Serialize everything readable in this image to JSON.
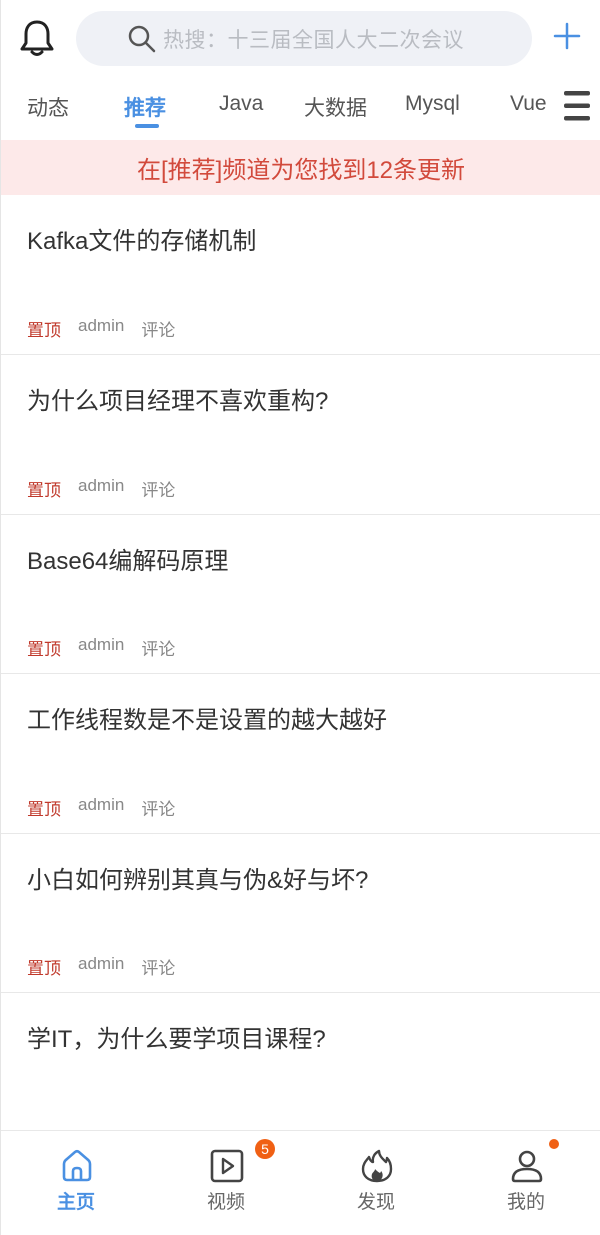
{
  "header": {
    "search_placeholder": "热搜：十三届全国人大二次会议"
  },
  "tabs": [
    {
      "label": "动态"
    },
    {
      "label": "推荐"
    },
    {
      "label": "Java"
    },
    {
      "label": "大数据"
    },
    {
      "label": "Mysql"
    },
    {
      "label": "Vue"
    }
  ],
  "notice": "在[推荐]频道为您找到12条更新",
  "articles": [
    {
      "title": "Kafka文件的存储机制",
      "pin": "置顶",
      "author": "admin",
      "comment": "评论"
    },
    {
      "title": "为什么项目经理不喜欢重构?",
      "pin": "置顶",
      "author": "admin",
      "comment": "评论"
    },
    {
      "title": "Base64编解码原理",
      "pin": "置顶",
      "author": "admin",
      "comment": "评论"
    },
    {
      "title": "工作线程数是不是设置的越大越好",
      "pin": "置顶",
      "author": "admin",
      "comment": "评论"
    },
    {
      "title": "小白如何辨别其真与伪&好与坏?",
      "pin": "置顶",
      "author": "admin",
      "comment": "评论"
    },
    {
      "title": "学IT，为什么要学项目课程?"
    }
  ],
  "bottom_nav": [
    {
      "label": "主页",
      "icon": "home-icon"
    },
    {
      "label": "视频",
      "icon": "video-icon",
      "badge": "5"
    },
    {
      "label": "发现",
      "icon": "discover-icon"
    },
    {
      "label": "我的",
      "icon": "user-icon"
    }
  ],
  "colors": {
    "accent": "#4a90e2",
    "notice_bg": "#fde9e9",
    "notice_text": "#d24a3c",
    "pin": "#c0392b",
    "badge": "#f06014"
  }
}
